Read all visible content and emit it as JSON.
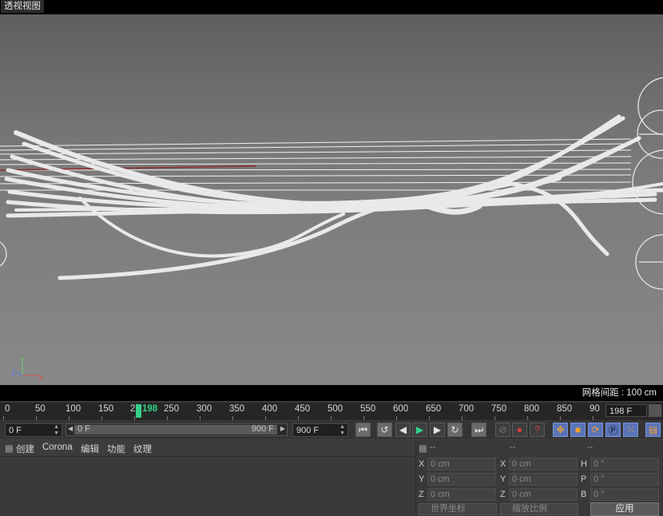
{
  "viewport": {
    "title": "透视视图",
    "grid_spacing": "网格间距 : 100 cm",
    "axes": {
      "x": "X",
      "y": "Y",
      "z": "Z"
    }
  },
  "timeline": {
    "ticks": [
      "0",
      "50",
      "100",
      "150",
      "2",
      "250",
      "300",
      "350",
      "400",
      "450",
      "500",
      "550",
      "600",
      "650",
      "700",
      "750",
      "800",
      "850",
      "90"
    ],
    "current_frame": "198",
    "end_frame_field": "198 F"
  },
  "transport": {
    "start_field": "0 F",
    "range_start": "0 F",
    "range_end": "900 F",
    "end_field": "900 F"
  },
  "material_panel": {
    "menu": [
      "创建",
      "Corona",
      "编辑",
      "功能",
      "纹理"
    ]
  },
  "coordinates": {
    "header_dashes": [
      "--",
      "--",
      "--"
    ],
    "rows": [
      [
        {
          "label": "X",
          "value": "0 cm"
        },
        {
          "label": "X",
          "value": "0 cm"
        },
        {
          "label": "H",
          "value": "0 °"
        }
      ],
      [
        {
          "label": "Y",
          "value": "0 cm"
        },
        {
          "label": "Y",
          "value": "0 cm"
        },
        {
          "label": "P",
          "value": "0 °"
        }
      ],
      [
        {
          "label": "Z",
          "value": "0 cm"
        },
        {
          "label": "Z",
          "value": "0 cm"
        },
        {
          "label": "B",
          "value": "0 °"
        }
      ]
    ],
    "mode_dropdown": "世界坐标",
    "scale_dropdown": "缩放比例",
    "apply_label": "应用"
  },
  "colors": {
    "playhead": "#34d18a",
    "accent_blue": "#5a74b8",
    "record_red": "#d9403a"
  }
}
